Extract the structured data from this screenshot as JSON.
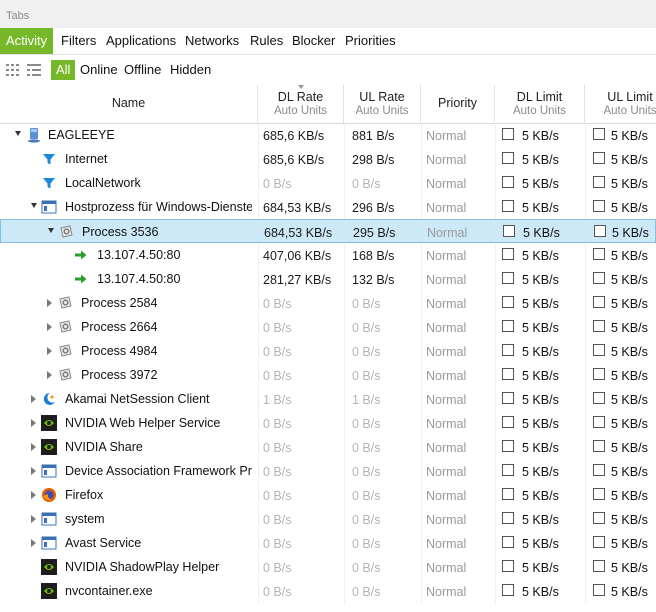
{
  "tabs_header": {
    "label": "Tabs"
  },
  "tabs": [
    {
      "label": "Activity",
      "active": true
    },
    {
      "label": "Filters"
    },
    {
      "label": "Applications"
    },
    {
      "label": "Networks"
    },
    {
      "label": "Rules"
    },
    {
      "label": "Blocker"
    },
    {
      "label": "Priorities"
    }
  ],
  "filters": [
    {
      "label": "All",
      "active": true
    },
    {
      "label": "Online"
    },
    {
      "label": "Offline"
    },
    {
      "label": "Hidden"
    }
  ],
  "columns": {
    "name": "Name",
    "dl_rate": "DL Rate",
    "dl_rate_sub": "Auto Units",
    "ul_rate": "UL Rate",
    "ul_rate_sub": "Auto Units",
    "priority": "Priority",
    "dl_limit": "DL Limit",
    "dl_limit_sub": "Auto Units",
    "ul_limit": "UL Limit",
    "ul_limit_sub": "Auto Units"
  },
  "colors": {
    "accent": "#76b82a",
    "selected_bg": "#cde8f7"
  },
  "rows": [
    {
      "name": "EAGLEEYE",
      "dl": "685,6 KB/s",
      "ul": "881 B/s",
      "priority": "Normal",
      "dl_limit": "5 KB/s",
      "ul_limit": "5 KB/s",
      "level": 0,
      "expand": "open",
      "icon": "computer-icon",
      "active": true
    },
    {
      "name": "Internet",
      "dl": "685,6 KB/s",
      "ul": "298 B/s",
      "priority": "Normal",
      "dl_limit": "5 KB/s",
      "ul_limit": "5 KB/s",
      "level": 1,
      "expand": "none",
      "icon": "funnel-icon",
      "active": true
    },
    {
      "name": "LocalNetwork",
      "dl": "0 B/s",
      "ul": "0 B/s",
      "priority": "Normal",
      "dl_limit": "5 KB/s",
      "ul_limit": "5 KB/s",
      "level": 1,
      "expand": "none",
      "icon": "funnel-icon",
      "active": false
    },
    {
      "name": "Hostprozess für Windows-Dienste",
      "dl": "684,53 KB/s",
      "ul": "296 B/s",
      "priority": "Normal",
      "dl_limit": "5 KB/s",
      "ul_limit": "5 KB/s",
      "level": 1,
      "expand": "open",
      "icon": "window-icon",
      "active": true
    },
    {
      "name": "Process 3536",
      "dl": "684,53 KB/s",
      "ul": "295 B/s",
      "priority": "Normal",
      "dl_limit": "5 KB/s",
      "ul_limit": "5 KB/s",
      "level": 2,
      "expand": "open",
      "icon": "gear-icon",
      "active": true,
      "selected": true
    },
    {
      "name": "13.107.4.50:80",
      "dl": "407,06 KB/s",
      "ul": "168 B/s",
      "priority": "Normal",
      "dl_limit": "5 KB/s",
      "ul_limit": "5 KB/s",
      "level": 3,
      "expand": "none",
      "icon": "arrow-right-icon",
      "active": true
    },
    {
      "name": "13.107.4.50:80",
      "dl": "281,27 KB/s",
      "ul": "132 B/s",
      "priority": "Normal",
      "dl_limit": "5 KB/s",
      "ul_limit": "5 KB/s",
      "level": 3,
      "expand": "none",
      "icon": "arrow-right-icon",
      "active": true
    },
    {
      "name": "Process 2584",
      "dl": "0 B/s",
      "ul": "0 B/s",
      "priority": "Normal",
      "dl_limit": "5 KB/s",
      "ul_limit": "5 KB/s",
      "level": 2,
      "expand": "closed",
      "icon": "gear-icon",
      "active": false
    },
    {
      "name": "Process 2664",
      "dl": "0 B/s",
      "ul": "0 B/s",
      "priority": "Normal",
      "dl_limit": "5 KB/s",
      "ul_limit": "5 KB/s",
      "level": 2,
      "expand": "closed",
      "icon": "gear-icon",
      "active": false
    },
    {
      "name": "Process 4984",
      "dl": "0 B/s",
      "ul": "0 B/s",
      "priority": "Normal",
      "dl_limit": "5 KB/s",
      "ul_limit": "5 KB/s",
      "level": 2,
      "expand": "closed",
      "icon": "gear-icon",
      "active": false
    },
    {
      "name": "Process 3972",
      "dl": "0 B/s",
      "ul": "0 B/s",
      "priority": "Normal",
      "dl_limit": "5 KB/s",
      "ul_limit": "5 KB/s",
      "level": 2,
      "expand": "closed",
      "icon": "gear-icon",
      "active": false
    },
    {
      "name": "Akamai NetSession Client",
      "dl": "1 B/s",
      "ul": "1 B/s",
      "priority": "Normal",
      "dl_limit": "5 KB/s",
      "ul_limit": "5 KB/s",
      "level": 1,
      "expand": "closed",
      "icon": "akamai-icon",
      "active": false
    },
    {
      "name": "NVIDIA Web Helper Service",
      "dl": "0 B/s",
      "ul": "0 B/s",
      "priority": "Normal",
      "dl_limit": "5 KB/s",
      "ul_limit": "5 KB/s",
      "level": 1,
      "expand": "closed",
      "icon": "nvidia-icon",
      "active": false
    },
    {
      "name": "NVIDIA Share",
      "dl": "0 B/s",
      "ul": "0 B/s",
      "priority": "Normal",
      "dl_limit": "5 KB/s",
      "ul_limit": "5 KB/s",
      "level": 1,
      "expand": "closed",
      "icon": "nvidia-icon",
      "active": false
    },
    {
      "name": "Device Association Framework Prov",
      "dl": "0 B/s",
      "ul": "0 B/s",
      "priority": "Normal",
      "dl_limit": "5 KB/s",
      "ul_limit": "5 KB/s",
      "level": 1,
      "expand": "closed",
      "icon": "window-icon",
      "active": false
    },
    {
      "name": "Firefox",
      "dl": "0 B/s",
      "ul": "0 B/s",
      "priority": "Normal",
      "dl_limit": "5 KB/s",
      "ul_limit": "5 KB/s",
      "level": 1,
      "expand": "closed",
      "icon": "firefox-icon",
      "active": false
    },
    {
      "name": "system",
      "dl": "0 B/s",
      "ul": "0 B/s",
      "priority": "Normal",
      "dl_limit": "5 KB/s",
      "ul_limit": "5 KB/s",
      "level": 1,
      "expand": "closed",
      "icon": "window-icon",
      "active": false
    },
    {
      "name": "Avast Service",
      "dl": "0 B/s",
      "ul": "0 B/s",
      "priority": "Normal",
      "dl_limit": "5 KB/s",
      "ul_limit": "5 KB/s",
      "level": 1,
      "expand": "closed",
      "icon": "window-icon",
      "active": false
    },
    {
      "name": "NVIDIA ShadowPlay Helper",
      "dl": "0 B/s",
      "ul": "0 B/s",
      "priority": "Normal",
      "dl_limit": "5 KB/s",
      "ul_limit": "5 KB/s",
      "level": 1,
      "expand": "none",
      "icon": "nvidia-icon",
      "active": false
    },
    {
      "name": "nvcontainer.exe",
      "dl": "0 B/s",
      "ul": "0 B/s",
      "priority": "Normal",
      "dl_limit": "5 KB/s",
      "ul_limit": "5 KB/s",
      "level": 1,
      "expand": "none",
      "icon": "nvidia-icon",
      "active": false
    }
  ]
}
